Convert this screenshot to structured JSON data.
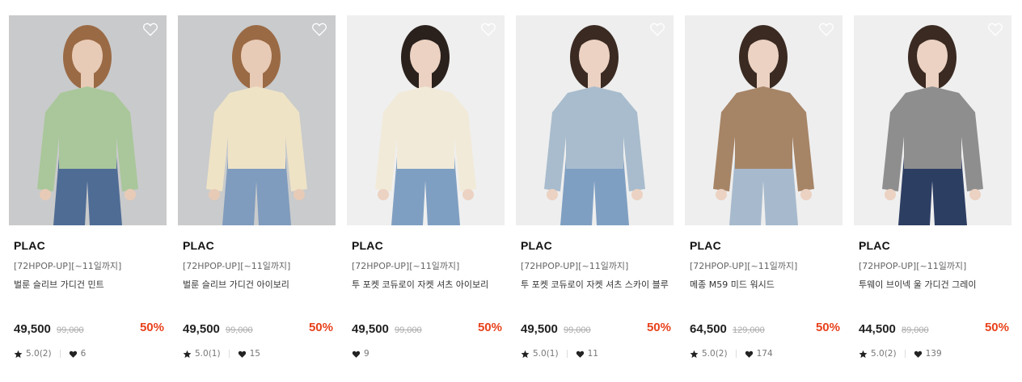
{
  "products": [
    {
      "brand": "PLAC",
      "promo": "[72HPOP-UP][~11일까지]",
      "name": "벌룬 슬리브 가디건 민트",
      "price": "49,500",
      "original_price": "99,000",
      "discount": "50%",
      "rating": "5.0(2)",
      "likes": "6",
      "colors": {
        "bg": "#c9cacb",
        "top": "#a9c79a",
        "bottom": "#4f6c95",
        "hair": "#9a6a45",
        "skin": "#e8cbb6"
      }
    },
    {
      "brand": "PLAC",
      "promo": "[72HPOP-UP][~11일까지]",
      "name": "벌룬 슬리브 가디건 아이보리",
      "price": "49,500",
      "original_price": "99,000",
      "discount": "50%",
      "rating": "5.0(1)",
      "likes": "15",
      "colors": {
        "bg": "#c9cbcc",
        "top": "#efe3c6",
        "bottom": "#7f9bbd",
        "hair": "#9a6a45",
        "skin": "#e8cbb6"
      }
    },
    {
      "brand": "PLAC",
      "promo": "[72HPOP-UP][~11일까지]",
      "name": "투 포켓 코듀로이 자켓 셔츠 아이보리",
      "price": "49,500",
      "original_price": "99,000",
      "discount": "50%",
      "rating": "",
      "likes": "9",
      "colors": {
        "bg": "#efefef",
        "top": "#f1ead8",
        "bottom": "#7f9fc2",
        "hair": "#2a211d",
        "skin": "#ecd2c2"
      }
    },
    {
      "brand": "PLAC",
      "promo": "[72HPOP-UP][~11일까지]",
      "name": "투 포켓 코듀로이 자켓 셔츠 스카이 블루",
      "price": "49,500",
      "original_price": "99,000",
      "discount": "50%",
      "rating": "5.0(1)",
      "likes": "11",
      "colors": {
        "bg": "#eeeeee",
        "top": "#a8bccd",
        "bottom": "#7f9fc2",
        "hair": "#3a2a22",
        "skin": "#ecd2c2"
      }
    },
    {
      "brand": "PLAC",
      "promo": "[72HPOP-UP][~11일까지]",
      "name": "메종 M59 미드 워시드",
      "price": "64,500",
      "original_price": "129,000",
      "discount": "50%",
      "rating": "5.0(2)",
      "likes": "174",
      "colors": {
        "bg": "#eeeeee",
        "top": "#a68466",
        "bottom": "#a7bacd",
        "hair": "#3a2a22",
        "skin": "#ecd2c2"
      }
    },
    {
      "brand": "PLAC",
      "promo": "[72HPOP-UP][~11일까지]",
      "name": "투웨이 브이넥 울 가디건 그레이",
      "price": "44,500",
      "original_price": "89,000",
      "discount": "50%",
      "rating": "5.0(2)",
      "likes": "139",
      "colors": {
        "bg": "#efefef",
        "top": "#8e8e8e",
        "bottom": "#2d3e63",
        "hair": "#3a2a22",
        "skin": "#ecd2c2"
      }
    }
  ],
  "accent_color": "#e8411c"
}
